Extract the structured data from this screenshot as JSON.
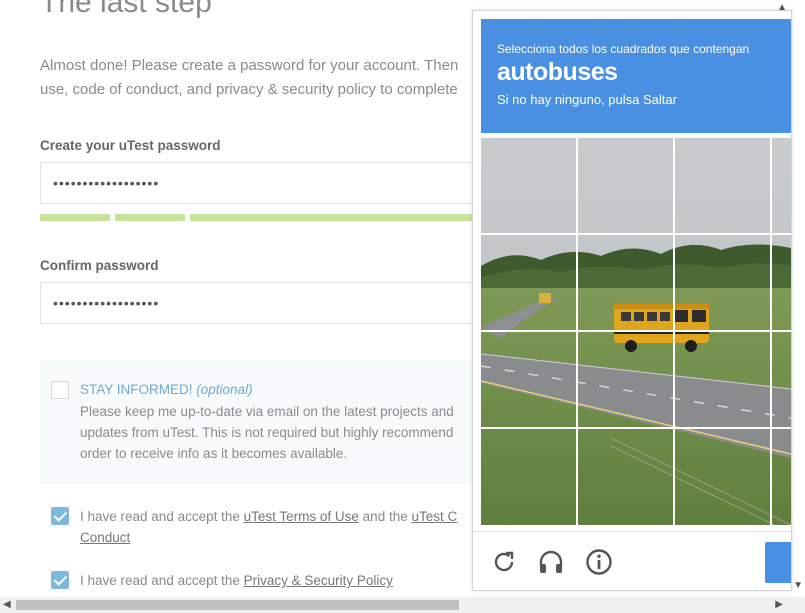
{
  "page": {
    "title": "The last step",
    "intro_line1": "Almost done! Please create a password for your account. Then",
    "intro_line2": "use, code of conduct, and privacy & security policy to complete"
  },
  "password": {
    "label": "Create your uTest password",
    "value": "••••••••••••••••••",
    "strength_segments": 3
  },
  "confirm": {
    "label": "Confirm password",
    "value": "••••••••••••••••••"
  },
  "stay_informed": {
    "title": "STAY INFORMED!",
    "optional": "(optional)",
    "text_line1": "Please keep me up-to-date via email on the latest projects and",
    "text_line2": "updates from uTest. This is not required but highly recommend",
    "text_line3": "order to receive info as it becomes available.",
    "checked": false
  },
  "terms": {
    "prefix": "I have read and accept the ",
    "link1": "uTest Terms of Use",
    "middle": " and the ",
    "link2": "uTest C",
    "line2_link": "Conduct",
    "checked": true
  },
  "privacy": {
    "prefix": "I have read and accept the ",
    "link": "Privacy & Security Policy",
    "checked": true
  },
  "captcha": {
    "instruction": "Selecciona todos los cuadrados que contengan",
    "target": "autobuses",
    "skip_hint": "Si no hay ninguno, pulsa Saltar",
    "grid_size": 4,
    "header_color": "#4a90e2",
    "footer_icons": [
      "reload-icon",
      "headphones-icon",
      "info-icon"
    ]
  },
  "colors": {
    "accent": "#4a90e2",
    "strength_bar": "#c7e49a",
    "checkbox": "#7cb7de",
    "informed_title": "#6fa9d2"
  }
}
